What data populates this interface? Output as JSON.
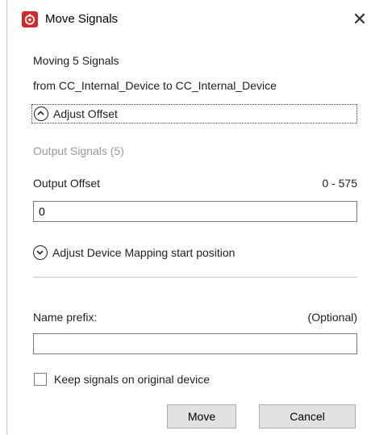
{
  "window": {
    "title": "Move Signals",
    "close_glyph": "✕"
  },
  "summary": {
    "moving_text": "Moving 5 Signals",
    "route_text": "from CC_Internal_Device to CC_Internal_Device"
  },
  "adjust_offset": {
    "label": "Adjust Offset",
    "expanded": true,
    "section_label": "Output Signals (5)",
    "field_label": "Output Offset",
    "range_text": "0 - 575",
    "value": "0"
  },
  "adjust_mapping": {
    "label": "Adjust Device Mapping start position",
    "expanded": false
  },
  "name_prefix": {
    "label": "Name prefix:",
    "optional_text": "(Optional)",
    "value": ""
  },
  "keep_signals": {
    "label": "Keep signals on original device",
    "checked": false
  },
  "buttons": {
    "move_label": "Move",
    "cancel_label": "Cancel"
  },
  "icons": {
    "app": "app-logo-icon",
    "close": "close-icon",
    "collapse": "chevron-up-circle-icon",
    "expand": "chevron-down-circle-icon"
  },
  "colors": {
    "app_icon": "#d62828",
    "muted_text": "#9a9a9a",
    "button_bg": "#e1e1e1"
  }
}
